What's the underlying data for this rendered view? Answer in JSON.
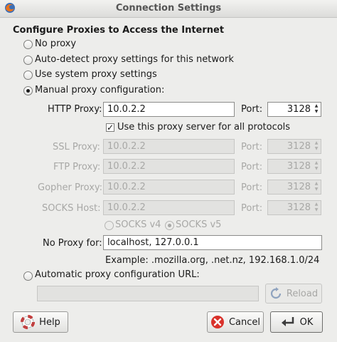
{
  "window": {
    "title": "Connection Settings"
  },
  "heading": "Configure Proxies to Access the Internet",
  "options": {
    "no_proxy": "No proxy",
    "auto_detect": "Auto-detect proxy settings for this network",
    "system": "Use system proxy settings",
    "manual": "Manual proxy configuration:",
    "auto_url": "Automatic proxy configuration URL:"
  },
  "selected_option": "manual",
  "http": {
    "label": "HTTP Proxy:",
    "value": "10.0.2.2",
    "port_label": "Port:",
    "port": "3128"
  },
  "use_same": {
    "label": "Use this proxy server for all protocols",
    "checked": true
  },
  "ssl": {
    "label": "SSL Proxy:",
    "value": "10.0.2.2",
    "port_label": "Port:",
    "port": "3128"
  },
  "ftp": {
    "label": "FTP Proxy:",
    "value": "10.0.2.2",
    "port_label": "Port:",
    "port": "3128"
  },
  "gopher": {
    "label": "Gopher Proxy:",
    "value": "10.0.2.2",
    "port_label": "Port:",
    "port": "3128"
  },
  "socks": {
    "label": "SOCKS Host:",
    "value": "10.0.2.2",
    "port_label": "Port:",
    "port": "3128"
  },
  "socks_version": {
    "v4": "SOCKS v4",
    "v5": "SOCKS v5",
    "selected": "v5"
  },
  "no_proxy_for": {
    "label": "No Proxy for:",
    "value": "localhost, 127.0.0.1",
    "example": "Example: .mozilla.org, .net.nz, 192.168.1.0/24"
  },
  "auto_url_value": "",
  "buttons": {
    "reload": "Reload",
    "help": "Help",
    "cancel": "Cancel",
    "ok": "OK"
  },
  "colors": {
    "window_bg": "#ededeb",
    "cancel_icon": "#d9322b",
    "help_icon": "#cc2a2a"
  }
}
